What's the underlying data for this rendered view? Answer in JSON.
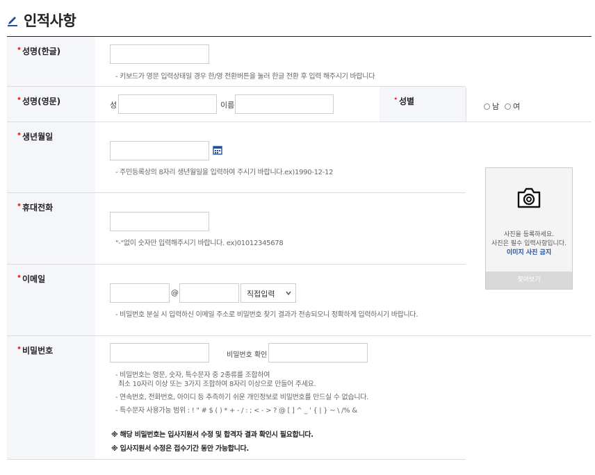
{
  "section_title": "인적사항",
  "fields": {
    "name_kr": {
      "label": "성명(한글)",
      "hint": "- 키보드가 영문 입력상태일 경우 한/영 전환버튼을 눌러 한글 전환 후 입력 해주시기 바랍니다"
    },
    "name_en": {
      "label": "성명(영문)",
      "last_label": "성",
      "first_label": "이름"
    },
    "gender": {
      "label": "성별",
      "options": [
        "남",
        "여"
      ]
    },
    "birth": {
      "label": "생년월일",
      "hint": "- 주민등록상의 8자리 생년월일을 입력하여 주시기 바랍니다.ex)1990-12-12"
    },
    "phone": {
      "label": "휴대전화",
      "hint": "\"-\"없이 숫자만 입력해주시기 바랍니다. ex)01012345678"
    },
    "email": {
      "label": "이메일",
      "at": "@",
      "domain_select": "직접입력",
      "hint": "- 비밀번호 분실 시 입력하신 이메일 주소로 비밀번호 찾기 결과가 전송되오니 정확하게 입력하시기 바랍니다."
    },
    "password": {
      "label": "비밀번호",
      "confirm_label": "비밀번호 확인",
      "hints": [
        "- 비밀번호는 영문, 숫자, 특수문자 중 2종류를 조합하여",
        "최소 10자리 이상 또는 3가지 조합하여 8자리 이상으로 만들어 주세요.",
        "- 연속번호, 전화번호, 아이디 등 추측하기 쉬운 개인정보로 비밀번호를 만드실 수 없습니다.",
        "- 특수문자 사용가능 범위 : ! \" # $ ( ) * + - / : ; < - > ? @ [ ] ^ _ ' { | } ~ \\ /% &"
      ],
      "notes": [
        "※ 해당 비밀번호는 입사지원서 수정 및 합격자 결과 확인시 필요합니다.",
        "※ 입사지원서 수정은 접수기간 동안 가능합니다."
      ]
    }
  },
  "photo": {
    "line1": "사진을 등록하세요.",
    "line2": "사진은 필수 입력사항입니다.",
    "line3": "이미지 사진 금지",
    "browse": "찾아보기"
  },
  "colors": {
    "required_dot": "#e03a3a",
    "accent_blue": "#1f4fa0",
    "label_bg": "#f5f6fa"
  }
}
